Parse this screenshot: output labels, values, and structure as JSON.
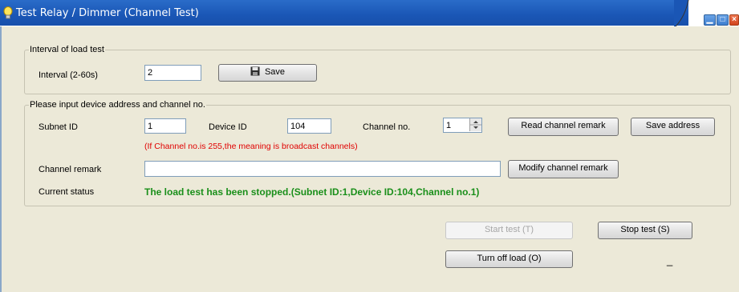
{
  "window": {
    "title": "Test Relay / Dimmer (Channel Test)",
    "title_bg": "#1a56b5",
    "icon": "lightbulb-icon"
  },
  "interval_group": {
    "legend": "Interval of load test",
    "label": "Interval (2-60s)",
    "value": "2",
    "save_label": "Save",
    "save_icon": "floppy-disk-icon"
  },
  "device_group": {
    "legend": "Please input device address and channel no.",
    "subnet_label": "Subnet ID",
    "subnet_value": "1",
    "device_label": "Device ID",
    "device_value": "104",
    "channel_label": "Channel no.",
    "channel_value": "1",
    "read_remark_label": "Read channel remark",
    "save_address_label": "Save address",
    "hint": "(If Channel no.is 255,the meaning is broadcast channels)",
    "hint_color": "#e00000",
    "remark_label": "Channel remark",
    "remark_value": "",
    "modify_remark_label": "Modify channel remark",
    "status_label": "Current status",
    "status_text": "The load test has been stopped.(Subnet ID:1,Device ID:104,Channel no.1)",
    "status_color": "#1a8f1a"
  },
  "actions": {
    "start_label": "Start test (T)",
    "stop_label": "Stop test (S)",
    "turnoff_label": "Turn off load (O)",
    "dash": "_"
  }
}
